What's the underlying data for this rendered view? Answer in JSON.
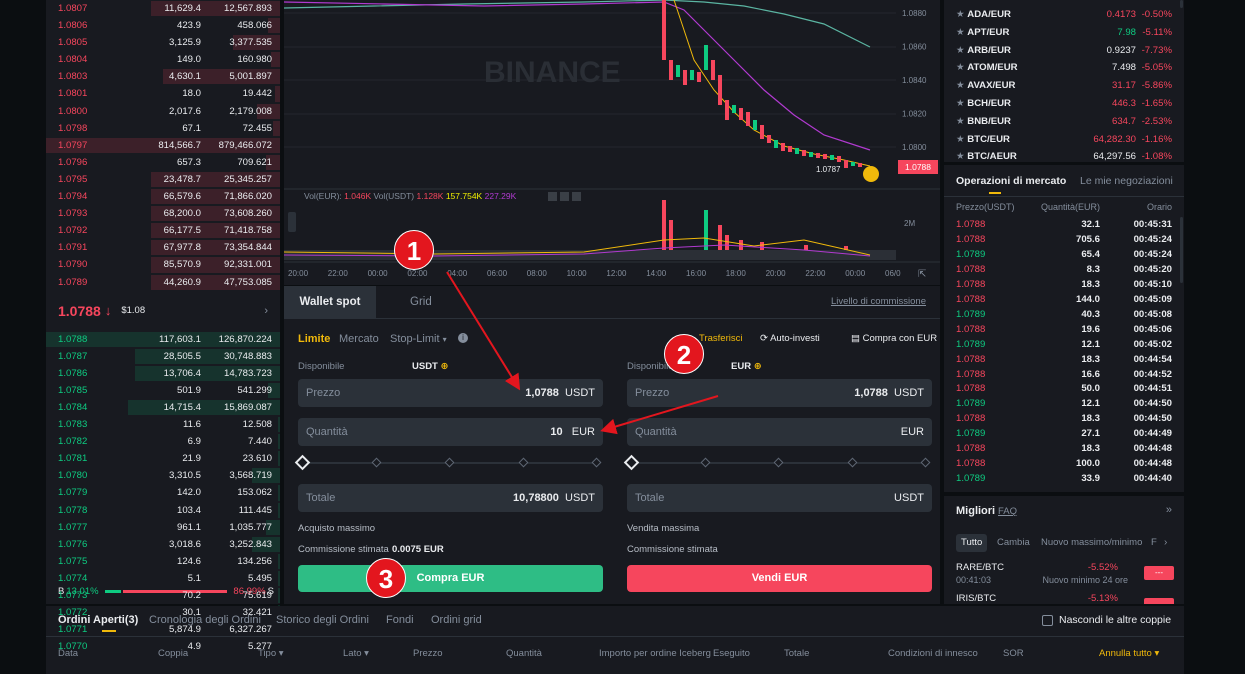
{
  "orderbook": {
    "asks": [
      [
        "1.0807",
        "11,629.4",
        "12,567.893"
      ],
      [
        "1.0806",
        "423.9",
        "458.066"
      ],
      [
        "1.0805",
        "3,125.9",
        "3,377.535"
      ],
      [
        "1.0804",
        "149.0",
        "160.980"
      ],
      [
        "1.0803",
        "4,630.1",
        "5,001.897"
      ],
      [
        "1.0801",
        "18.0",
        "19.442"
      ],
      [
        "1.0800",
        "2,017.6",
        "2,179.008"
      ],
      [
        "1.0798",
        "67.1",
        "72.455"
      ],
      [
        "1.0797",
        "814,566.7",
        "879,466.072"
      ],
      [
        "1.0796",
        "657.3",
        "709.621"
      ],
      [
        "1.0795",
        "23,478.7",
        "25,345.257"
      ],
      [
        "1.0794",
        "66,579.6",
        "71,866.020"
      ],
      [
        "1.0793",
        "68,200.0",
        "73,608.260"
      ],
      [
        "1.0792",
        "66,177.5",
        "71,418.758"
      ],
      [
        "1.0791",
        "67,977.8",
        "73,354.844"
      ],
      [
        "1.0790",
        "85,570.9",
        "92,331.001"
      ],
      [
        "1.0789",
        "44,260.9",
        "47,753.085"
      ]
    ],
    "ask_fill": [
      0.55,
      0.05,
      0.2,
      0.04,
      0.5,
      0.02,
      0.1,
      0.03,
      1.0,
      0.06,
      0.55,
      0.55,
      0.55,
      0.55,
      0.55,
      0.55,
      0.55
    ],
    "mid_price": "1.0788",
    "mid_arrow": "↓",
    "mid_usd": "$1.08",
    "mid_more": "›",
    "bids": [
      [
        "1.0788",
        "117,603.1",
        "126,870.224"
      ],
      [
        "1.0787",
        "28,505.5",
        "30,748.883"
      ],
      [
        "1.0786",
        "13,706.4",
        "14,783.723"
      ],
      [
        "1.0785",
        "501.9",
        "541.299"
      ],
      [
        "1.0784",
        "14,715.4",
        "15,869.087"
      ],
      [
        "1.0783",
        "11.6",
        "12.508"
      ],
      [
        "1.0782",
        "6.9",
        "7.440"
      ],
      [
        "1.0781",
        "21.9",
        "23.610"
      ],
      [
        "1.0780",
        "3,310.5",
        "3,568.719"
      ],
      [
        "1.0779",
        "142.0",
        "153.062"
      ],
      [
        "1.0778",
        "103.4",
        "111.445"
      ],
      [
        "1.0777",
        "961.1",
        "1,035.777"
      ],
      [
        "1.0776",
        "3,018.6",
        "3,252.843"
      ],
      [
        "1.0775",
        "124.6",
        "134.256"
      ],
      [
        "1.0774",
        "5.1",
        "5.495"
      ],
      [
        "1.0773",
        "70.2",
        "75.619"
      ],
      [
        "1.0772",
        "30.1",
        "32.421"
      ],
      [
        "1.0771",
        "5,874.9",
        "6,327.267"
      ],
      [
        "1.0770",
        "4.9",
        "5.277"
      ]
    ],
    "bid_fill": [
      1.0,
      0.62,
      0.62,
      0.05,
      0.65,
      0.01,
      0.01,
      0.01,
      0.12,
      0.01,
      0.01,
      0.06,
      0.12,
      0.01,
      0.01,
      0.01,
      0.01,
      0.62,
      0.01
    ],
    "buy_label": "B",
    "buy_pct": "13.01%",
    "sell_pct": "86.99%",
    "sell_label": "S",
    "buy_ratio": 13.01
  },
  "chart": {
    "watermark": "BINANCE",
    "price_ticks": [
      "1.0880",
      "1.0860",
      "1.0840",
      "1.0820",
      "1.0800"
    ],
    "last_price": "1.0788",
    "low_label": "1.0787",
    "vol_legend": {
      "label1": "Vol(EUR):",
      "v1": "1.046K",
      "label2": "Vol(USDT)",
      "v2": "1.128K",
      "v3": "157.754K",
      "v4": "227.29K"
    },
    "vol_tick": "2M",
    "time_ticks": [
      "20:00",
      "22:00",
      "00:00",
      "02:00",
      "04:00",
      "06:00",
      "08:00",
      "10:00",
      "12:00",
      "14:00",
      "16:00",
      "18:00",
      "20:00",
      "22:00",
      "00:00",
      "06/0"
    ]
  },
  "trade": {
    "tab_spot": "Wallet spot",
    "tab_grid": "Grid",
    "commission_link": "Livello di commissione",
    "order_types": {
      "limit": "Limite",
      "market": "Mercato",
      "stop": "Stop-Limit"
    },
    "transfer": "Trasferisci",
    "auto_invest": "Auto-investi",
    "buy_with_eur": "Compra con EUR",
    "buy": {
      "available_label": "Disponibile",
      "available_ccy": "USDT",
      "price_label": "Prezzo",
      "price": "1,0788",
      "price_ccy": "USDT",
      "qty_label": "Quantità",
      "qty": "10",
      "qty_ccy": "EUR",
      "total_label": "Totale",
      "total": "10,78800",
      "total_ccy": "USDT",
      "max_label": "Acquisto massimo",
      "fee_label": "Commissione stimata",
      "fee": "0.0075 EUR",
      "button": "Compra EUR"
    },
    "sell": {
      "available_label": "Disponibile",
      "available_ccy": "EUR",
      "price_label": "Prezzo",
      "price": "1,0788",
      "price_ccy": "USDT",
      "qty_label": "Quantità",
      "qty_ccy": "EUR",
      "total_label": "Totale",
      "total_ccy": "USDT",
      "max_label": "Vendita massima",
      "fee_label": "Commissione stimata",
      "button": "Vendi EUR"
    }
  },
  "markets": [
    [
      "ADA/EUR",
      "0.4173",
      "-0.50%",
      "r"
    ],
    [
      "APT/EUR",
      "7.98",
      "-5.11%",
      "g"
    ],
    [
      "ARB/EUR",
      "0.9237",
      "-7.73%",
      "w"
    ],
    [
      "ATOM/EUR",
      "7.498",
      "-5.05%",
      "w"
    ],
    [
      "AVAX/EUR",
      "31.17",
      "-5.86%",
      "r"
    ],
    [
      "BCH/EUR",
      "446.3",
      "-1.65%",
      "r"
    ],
    [
      "BNB/EUR",
      "634.7",
      "-2.53%",
      "r"
    ],
    [
      "BTC/EUR",
      "64,282.30",
      "-1.16%",
      "r"
    ],
    [
      "BTC/AEUR",
      "64,297.56",
      "-1.08%",
      "w"
    ]
  ],
  "trades": {
    "title": "Operazioni di mercato",
    "title2": "Le mie negoziazioni",
    "headers": [
      "Prezzo(USDT)",
      "Quantità(EUR)",
      "Orario"
    ],
    "rows": [
      [
        "1.0788",
        "32.1",
        "00:45:31",
        "r"
      ],
      [
        "1.0788",
        "705.6",
        "00:45:24",
        "r"
      ],
      [
        "1.0789",
        "65.4",
        "00:45:24",
        "g"
      ],
      [
        "1.0788",
        "8.3",
        "00:45:20",
        "r"
      ],
      [
        "1.0788",
        "18.3",
        "00:45:10",
        "r"
      ],
      [
        "1.0788",
        "144.0",
        "00:45:09",
        "r"
      ],
      [
        "1.0789",
        "40.3",
        "00:45:08",
        "g"
      ],
      [
        "1.0788",
        "19.6",
        "00:45:06",
        "r"
      ],
      [
        "1.0789",
        "12.1",
        "00:45:02",
        "g"
      ],
      [
        "1.0788",
        "18.3",
        "00:44:54",
        "r"
      ],
      [
        "1.0788",
        "16.6",
        "00:44:52",
        "r"
      ],
      [
        "1.0788",
        "50.0",
        "00:44:51",
        "r"
      ],
      [
        "1.0789",
        "12.1",
        "00:44:50",
        "g"
      ],
      [
        "1.0788",
        "18.3",
        "00:44:50",
        "r"
      ],
      [
        "1.0789",
        "27.1",
        "00:44:49",
        "g"
      ],
      [
        "1.0788",
        "18.3",
        "00:44:48",
        "r"
      ],
      [
        "1.0788",
        "100.0",
        "00:44:48",
        "r"
      ],
      [
        "1.0789",
        "33.9",
        "00:44:40",
        "g"
      ]
    ]
  },
  "movers": {
    "title": "Migliori",
    "faq": "FAQ",
    "tabs": [
      "Tutto",
      "Cambia",
      "Nuovo massimo/minimo",
      "F"
    ],
    "rows": [
      [
        "RARE/BTC",
        "00:41:03",
        "-5.52%",
        "Nuovo minimo 24 ore",
        "---"
      ],
      [
        "IRIS/BTC",
        "",
        "-5.13%",
        "",
        ""
      ]
    ]
  },
  "orders": {
    "tabs": [
      "Ordini Aperti(3)",
      "Cronologia degli Ordini",
      "Storico degli Ordini",
      "Fondi",
      "Ordini grid"
    ],
    "hide_label": "Nascondi le altre coppie",
    "cols": [
      "Data",
      "Coppia",
      "Tipo",
      "Lato",
      "Prezzo",
      "Quantità",
      "Importo per ordine Iceberg",
      "Eseguito",
      "Totale",
      "Condizioni di innesco",
      "SOR"
    ],
    "cancel_all": "Annulla tutto"
  },
  "annotations": [
    "1",
    "2",
    "3"
  ]
}
